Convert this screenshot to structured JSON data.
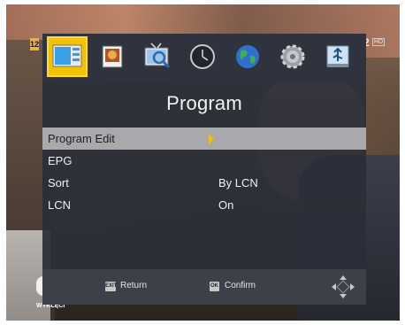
{
  "menu": {
    "title": "Program",
    "icons": [
      {
        "name": "program-icon",
        "selected": true
      },
      {
        "name": "picture-icon",
        "selected": false
      },
      {
        "name": "channel-search-icon",
        "selected": false
      },
      {
        "name": "time-icon",
        "selected": false
      },
      {
        "name": "language-icon",
        "selected": false
      },
      {
        "name": "system-settings-icon",
        "selected": false
      },
      {
        "name": "usb-icon",
        "selected": false
      }
    ],
    "items": [
      {
        "label": "Program Edit",
        "value": "",
        "highlighted": true
      },
      {
        "label": "EPG",
        "value": "",
        "highlighted": false
      },
      {
        "label": "Sort",
        "value": "By LCN",
        "highlighted": false
      },
      {
        "label": "LCN",
        "value": "On",
        "highlighted": false
      }
    ]
  },
  "footer": {
    "exit_key": "EXIT",
    "exit_label": "Return",
    "ok_key": "OK",
    "ok_label": "Confirm"
  },
  "background": {
    "channel_number_left": "12",
    "channel_number_right": "2",
    "hd_badge": "HD",
    "logo_text": "WYKLĘCI"
  },
  "colors": {
    "accent": "#f2c200",
    "panel": "#2a2e38",
    "highlight_row": "#a9a9ad"
  }
}
